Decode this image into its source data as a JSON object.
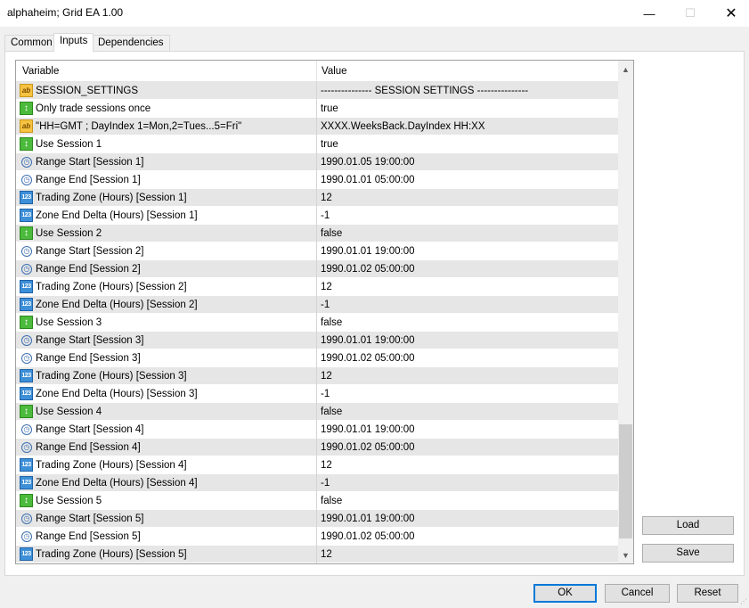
{
  "window": {
    "title": "alphaheim; Grid EA 1.00",
    "minimize_glyph": "—",
    "maximize_glyph": "☐",
    "close_glyph": "✕"
  },
  "tabs": [
    {
      "label": "Common"
    },
    {
      "label": "Inputs",
      "active": true
    },
    {
      "label": "Dependencies"
    }
  ],
  "grid": {
    "headers": {
      "variable": "Variable",
      "value": "Value"
    },
    "rows": [
      {
        "icon": "ab",
        "variable": "SESSION_SETTINGS",
        "value": "--------------- SESSION SETTINGS ---------------"
      },
      {
        "icon": "bool",
        "variable": "Only trade sessions once",
        "value": "true"
      },
      {
        "icon": "ab",
        "variable": "\"HH=GMT ; DayIndex 1=Mon,2=Tues...5=Fri\"",
        "value": "XXXX.WeeksBack.DayIndex HH:XX"
      },
      {
        "icon": "bool",
        "variable": "Use Session 1",
        "value": "true"
      },
      {
        "icon": "time",
        "variable": "Range Start [Session 1]",
        "value": "1990.01.05 19:00:00"
      },
      {
        "icon": "time",
        "variable": "Range End [Session 1]",
        "value": "1990.01.01 05:00:00"
      },
      {
        "icon": "num",
        "variable": "Trading Zone (Hours) [Session 1]",
        "value": "12"
      },
      {
        "icon": "num",
        "variable": "Zone End Delta (Hours) [Session 1]",
        "value": "-1"
      },
      {
        "icon": "bool",
        "variable": "Use Session 2",
        "value": "false"
      },
      {
        "icon": "time",
        "variable": "Range Start [Session 2]",
        "value": "1990.01.01 19:00:00"
      },
      {
        "icon": "time",
        "variable": "Range End [Session 2]",
        "value": "1990.01.02 05:00:00"
      },
      {
        "icon": "num",
        "variable": "Trading Zone (Hours) [Session 2]",
        "value": "12"
      },
      {
        "icon": "num",
        "variable": "Zone End Delta (Hours) [Session 2]",
        "value": "-1"
      },
      {
        "icon": "bool",
        "variable": "Use Session 3",
        "value": "false"
      },
      {
        "icon": "time",
        "variable": "Range Start [Session 3]",
        "value": "1990.01.01 19:00:00"
      },
      {
        "icon": "time",
        "variable": "Range End [Session 3]",
        "value": "1990.01.02 05:00:00"
      },
      {
        "icon": "num",
        "variable": "Trading Zone (Hours) [Session 3]",
        "value": "12"
      },
      {
        "icon": "num",
        "variable": "Zone End Delta (Hours) [Session 3]",
        "value": "-1"
      },
      {
        "icon": "bool",
        "variable": "Use Session 4",
        "value": "false"
      },
      {
        "icon": "time",
        "variable": "Range Start [Session 4]",
        "value": "1990.01.01 19:00:00"
      },
      {
        "icon": "time",
        "variable": "Range End [Session 4]",
        "value": "1990.01.02 05:00:00"
      },
      {
        "icon": "num",
        "variable": "Trading Zone (Hours) [Session 4]",
        "value": "12"
      },
      {
        "icon": "num",
        "variable": "Zone End Delta (Hours) [Session 4]",
        "value": "-1"
      },
      {
        "icon": "bool",
        "variable": "Use Session 5",
        "value": "false"
      },
      {
        "icon": "time",
        "variable": "Range Start [Session 5]",
        "value": "1990.01.01 19:00:00"
      },
      {
        "icon": "time",
        "variable": "Range End [Session 5]",
        "value": "1990.01.02 05:00:00"
      },
      {
        "icon": "num",
        "variable": "Trading Zone (Hours) [Session 5]",
        "value": "12"
      }
    ]
  },
  "icon_glyphs": {
    "ab": "ab",
    "bool": "↕",
    "time": "◷",
    "num": "123"
  },
  "buttons": {
    "load": "Load",
    "save": "Save",
    "ok": "OK",
    "cancel": "Cancel",
    "reset": "Reset"
  },
  "colors": {
    "row_alt": "#e6e6e6",
    "ok_border": "#0078d7"
  }
}
